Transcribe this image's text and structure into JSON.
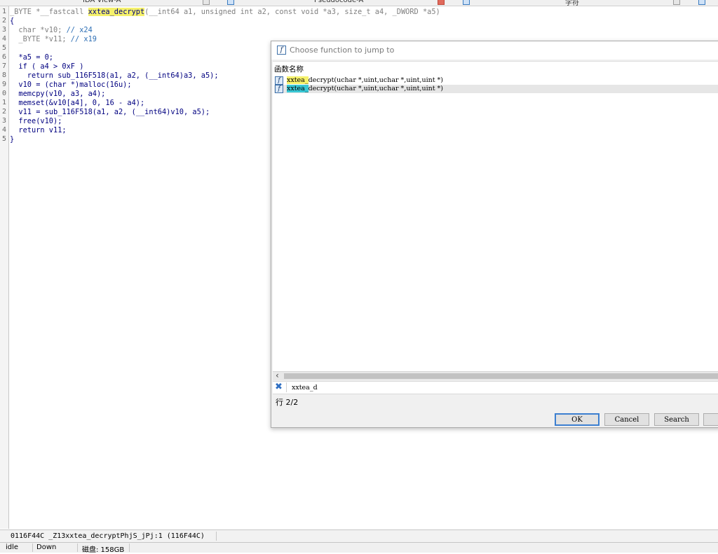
{
  "tabs": {
    "ida_view": "IDA View-A",
    "pseudocode": "Pseudocode-A",
    "strings": "字符"
  },
  "editor": {
    "line_numbers": [
      "1",
      "2",
      "3",
      "4",
      "5",
      "6",
      "7",
      "8",
      "9",
      "0",
      "1",
      "2",
      "3",
      "4",
      "5"
    ],
    "signature": {
      "prefix": "_BYTE *__fastcall ",
      "name": "xxtea_decrypt",
      "suffix": "(__int64 a1, unsigned int a2, const void *a3, size_t a4, _DWORD *a5)"
    },
    "open_brace": "{",
    "decl1": {
      "code": "  char *v10; ",
      "comment": "// x24"
    },
    "decl2": {
      "code": "  _BYTE *v11; ",
      "comment": "// x19"
    },
    "body": [
      "  *a5 = 0;",
      "  if ( a4 > 0xF )",
      "    return sub_116F518(a1, a2, (__int64)a3, a5);",
      "  v10 = (char *)malloc(16u);",
      "  memcpy(v10, a3, a4);",
      "  memset(&v10[a4], 0, 16 - a4);",
      "  v11 = sub_116F518(a1, a2, (__int64)v10, a5);",
      "  free(v10);",
      "  return v11;"
    ],
    "close_brace": "}"
  },
  "status": {
    "location": "0116F44C _Z13xxtea_decryptPhjS_jPj:1 (116F44C)"
  },
  "bottom": {
    "state": "idle",
    "direction": "Down",
    "disk": "磁盘: 158GB"
  },
  "dialog": {
    "title": "Choose function to jump to",
    "column_header": "函数名称",
    "rows": [
      {
        "match": "xxtea_",
        "rest": "decrypt(uchar *,uint,uchar *,uint,uint *)"
      },
      {
        "match": "xxtea_",
        "rest": "decrypt(uchar *,uint,uchar *,uint,uint *)"
      }
    ],
    "filter_value": "xxtea_d",
    "row_count": "行 2/2",
    "buttons": {
      "ok": "OK",
      "cancel": "Cancel",
      "search": "Search"
    }
  }
}
